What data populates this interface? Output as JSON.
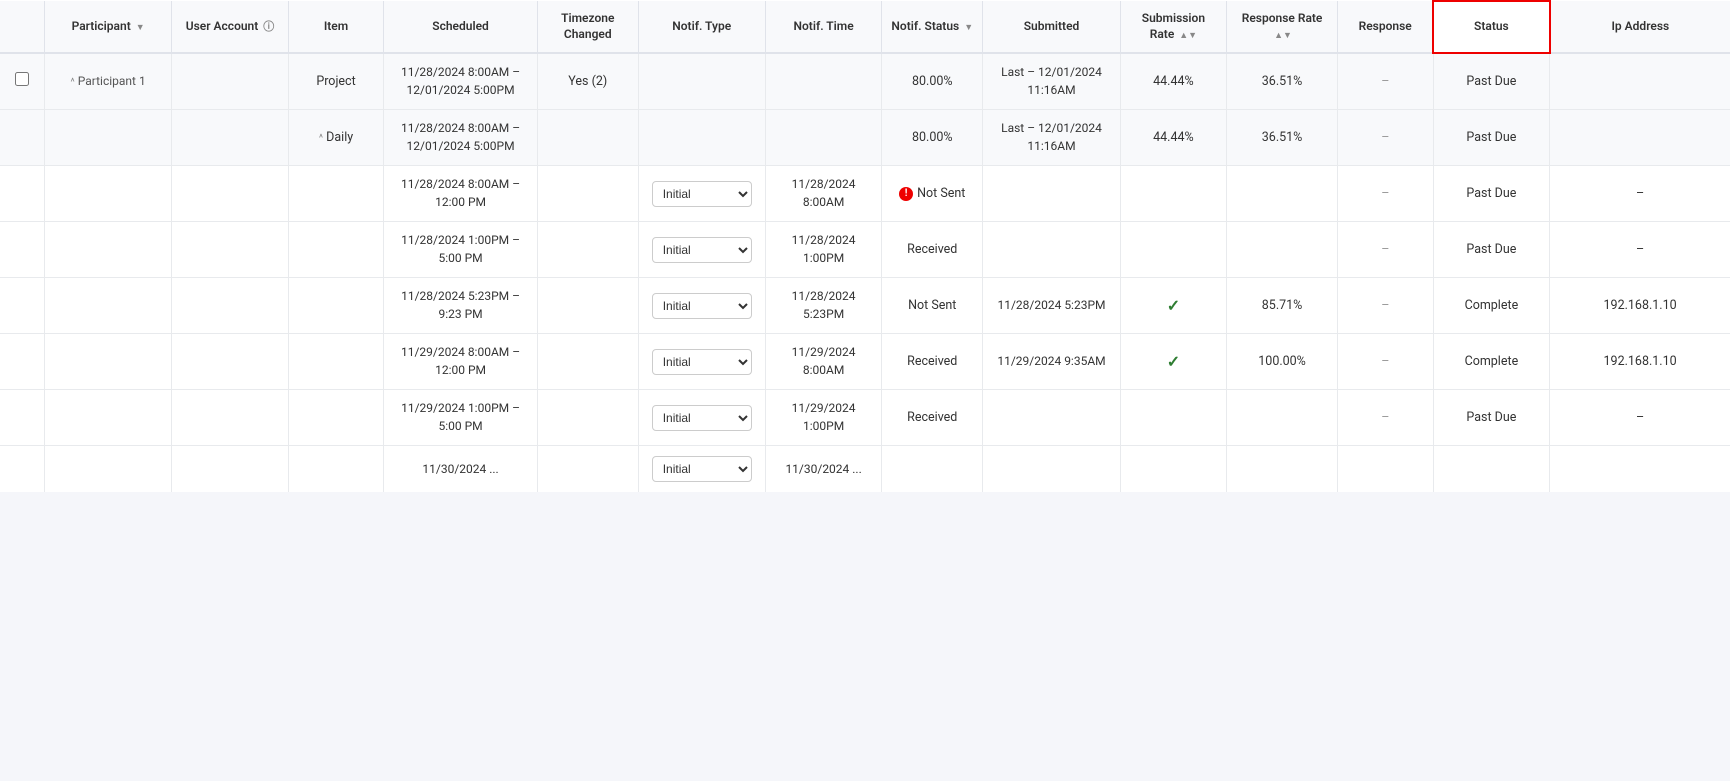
{
  "colors": {
    "statusHighlight": "#cc0000",
    "checkGreen": "#2e7d32",
    "errorRed": "#dd0000"
  },
  "table": {
    "headers": [
      {
        "key": "checkbox",
        "label": "",
        "sortable": false,
        "info": false
      },
      {
        "key": "participant",
        "label": "Participant",
        "sortable": true,
        "info": false
      },
      {
        "key": "useraccount",
        "label": "User Account",
        "sortable": false,
        "info": true
      },
      {
        "key": "item",
        "label": "Item",
        "sortable": false,
        "info": false
      },
      {
        "key": "scheduled",
        "label": "Scheduled",
        "sortable": false,
        "info": false
      },
      {
        "key": "timezone",
        "label": "Timezone Changed",
        "sortable": false,
        "info": false
      },
      {
        "key": "notiftype",
        "label": "Notif. Type",
        "sortable": false,
        "info": false
      },
      {
        "key": "notiftime",
        "label": "Notif. Time",
        "sortable": false,
        "info": false
      },
      {
        "key": "notifstatus",
        "label": "Notif. Status",
        "sortable": true,
        "info": false
      },
      {
        "key": "submitted",
        "label": "Submitted",
        "sortable": false,
        "info": false
      },
      {
        "key": "submissionrate",
        "label": "Submission Rate",
        "sortable": true,
        "info": false
      },
      {
        "key": "responserate",
        "label": "Response Rate",
        "sortable": true,
        "info": false
      },
      {
        "key": "response",
        "label": "Response",
        "sortable": false,
        "info": false
      },
      {
        "key": "status",
        "label": "Status",
        "sortable": false,
        "info": false,
        "highlighted": true
      },
      {
        "key": "ipaddress",
        "label": "Ip Address",
        "sortable": false,
        "info": false
      }
    ],
    "rows": [
      {
        "type": "group-header",
        "checkbox": true,
        "participant": "^ Participant 1",
        "useraccount": "",
        "item": "Project",
        "scheduled": "11/28/2024 8:00AM – 12/01/2024 5:00PM",
        "timezone": "Yes (2)",
        "notiftype": "",
        "notiftime": "",
        "notifstatus": "80.00%",
        "submitted": "Last – 12/01/2024 11:16AM",
        "submissionrate": "44.44%",
        "responserate": "36.51%",
        "response": "–",
        "status": "Past Due",
        "ipaddress": ""
      },
      {
        "type": "sub-header",
        "checkbox": false,
        "participant": "",
        "useraccount": "",
        "item": "^ Daily",
        "scheduled": "11/28/2024 8:00AM – 12/01/2024 5:00PM",
        "timezone": "",
        "notiftype": "",
        "notiftime": "",
        "notifstatus": "80.00%",
        "submitted": "Last – 12/01/2024 11:16AM",
        "submissionrate": "44.44%",
        "responserate": "36.51%",
        "response": "–",
        "status": "Past Due",
        "ipaddress": ""
      },
      {
        "type": "data",
        "checkbox": false,
        "participant": "",
        "useraccount": "",
        "item": "",
        "scheduled": "11/28/2024 8:00AM – 12:00 PM",
        "timezone": "",
        "notiftype": "Initial",
        "notiftime": "11/28/2024 8:00AM",
        "notifstatus": "Not Sent",
        "notifstatus_error": true,
        "submitted": "",
        "submissionrate": "",
        "responserate": "",
        "response": "–",
        "status": "Past Due",
        "ipaddress": "–"
      },
      {
        "type": "data",
        "checkbox": false,
        "participant": "",
        "useraccount": "",
        "item": "",
        "scheduled": "11/28/2024 1:00PM – 5:00 PM",
        "timezone": "",
        "notiftype": "Initial",
        "notiftime": "11/28/2024 1:00PM",
        "notifstatus": "Received",
        "notifstatus_error": false,
        "submitted": "",
        "submissionrate": "",
        "responserate": "",
        "response": "–",
        "status": "Past Due",
        "ipaddress": "–"
      },
      {
        "type": "data",
        "checkbox": false,
        "participant": "",
        "useraccount": "",
        "item": "",
        "scheduled": "11/28/2024 5:23PM – 9:23 PM",
        "timezone": "",
        "notiftype": "Initial",
        "notiftime": "11/28/2024 5:23PM",
        "notifstatus": "Not Sent",
        "notifstatus_error": false,
        "submitted": "11/28/2024 5:23PM",
        "submissionrate": "",
        "responserate": "85.71%",
        "response": "–",
        "status": "Complete",
        "ipaddress": "192.168.1.10",
        "has_check": true
      },
      {
        "type": "data",
        "checkbox": false,
        "participant": "",
        "useraccount": "",
        "item": "",
        "scheduled": "11/29/2024 8:00AM – 12:00 PM",
        "timezone": "",
        "notiftype": "Initial",
        "notiftime": "11/29/2024 8:00AM",
        "notifstatus": "Received",
        "notifstatus_error": false,
        "submitted": "11/29/2024 9:35AM",
        "submissionrate": "",
        "responserate": "100.00%",
        "response": "–",
        "status": "Complete",
        "ipaddress": "192.168.1.10",
        "has_check": true
      },
      {
        "type": "data",
        "checkbox": false,
        "participant": "",
        "useraccount": "",
        "item": "",
        "scheduled": "11/29/2024 1:00PM – 5:00 PM",
        "timezone": "",
        "notiftype": "Initial",
        "notiftime": "11/29/2024 1:00PM",
        "notifstatus": "Received",
        "notifstatus_error": false,
        "submitted": "",
        "submissionrate": "",
        "responserate": "",
        "response": "–",
        "status": "Past Due",
        "ipaddress": "–"
      },
      {
        "type": "data-partial",
        "checkbox": false,
        "participant": "",
        "useraccount": "",
        "item": "",
        "scheduled": "11/30/2024 ...",
        "timezone": "",
        "notiftype": "Initial",
        "notiftime": "11/30/2024 ...",
        "notifstatus": "",
        "notifstatus_error": false,
        "submitted": "",
        "submissionrate": "",
        "responserate": "",
        "response": "",
        "status": "",
        "ipaddress": ""
      }
    ]
  }
}
